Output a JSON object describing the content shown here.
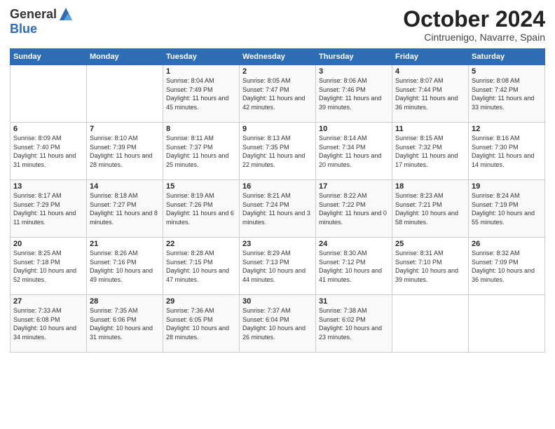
{
  "header": {
    "logo_line1": "General",
    "logo_line2": "Blue",
    "month_title": "October 2024",
    "subtitle": "Cintruenigo, Navarre, Spain"
  },
  "days_of_week": [
    "Sunday",
    "Monday",
    "Tuesday",
    "Wednesday",
    "Thursday",
    "Friday",
    "Saturday"
  ],
  "weeks": [
    [
      {
        "day": "",
        "info": ""
      },
      {
        "day": "",
        "info": ""
      },
      {
        "day": "1",
        "info": "Sunrise: 8:04 AM\nSunset: 7:49 PM\nDaylight: 11 hours and 45 minutes."
      },
      {
        "day": "2",
        "info": "Sunrise: 8:05 AM\nSunset: 7:47 PM\nDaylight: 11 hours and 42 minutes."
      },
      {
        "day": "3",
        "info": "Sunrise: 8:06 AM\nSunset: 7:46 PM\nDaylight: 11 hours and 39 minutes."
      },
      {
        "day": "4",
        "info": "Sunrise: 8:07 AM\nSunset: 7:44 PM\nDaylight: 11 hours and 36 minutes."
      },
      {
        "day": "5",
        "info": "Sunrise: 8:08 AM\nSunset: 7:42 PM\nDaylight: 11 hours and 33 minutes."
      }
    ],
    [
      {
        "day": "6",
        "info": "Sunrise: 8:09 AM\nSunset: 7:40 PM\nDaylight: 11 hours and 31 minutes."
      },
      {
        "day": "7",
        "info": "Sunrise: 8:10 AM\nSunset: 7:39 PM\nDaylight: 11 hours and 28 minutes."
      },
      {
        "day": "8",
        "info": "Sunrise: 8:11 AM\nSunset: 7:37 PM\nDaylight: 11 hours and 25 minutes."
      },
      {
        "day": "9",
        "info": "Sunrise: 8:13 AM\nSunset: 7:35 PM\nDaylight: 11 hours and 22 minutes."
      },
      {
        "day": "10",
        "info": "Sunrise: 8:14 AM\nSunset: 7:34 PM\nDaylight: 11 hours and 20 minutes."
      },
      {
        "day": "11",
        "info": "Sunrise: 8:15 AM\nSunset: 7:32 PM\nDaylight: 11 hours and 17 minutes."
      },
      {
        "day": "12",
        "info": "Sunrise: 8:16 AM\nSunset: 7:30 PM\nDaylight: 11 hours and 14 minutes."
      }
    ],
    [
      {
        "day": "13",
        "info": "Sunrise: 8:17 AM\nSunset: 7:29 PM\nDaylight: 11 hours and 11 minutes."
      },
      {
        "day": "14",
        "info": "Sunrise: 8:18 AM\nSunset: 7:27 PM\nDaylight: 11 hours and 8 minutes."
      },
      {
        "day": "15",
        "info": "Sunrise: 8:19 AM\nSunset: 7:26 PM\nDaylight: 11 hours and 6 minutes."
      },
      {
        "day": "16",
        "info": "Sunrise: 8:21 AM\nSunset: 7:24 PM\nDaylight: 11 hours and 3 minutes."
      },
      {
        "day": "17",
        "info": "Sunrise: 8:22 AM\nSunset: 7:22 PM\nDaylight: 11 hours and 0 minutes."
      },
      {
        "day": "18",
        "info": "Sunrise: 8:23 AM\nSunset: 7:21 PM\nDaylight: 10 hours and 58 minutes."
      },
      {
        "day": "19",
        "info": "Sunrise: 8:24 AM\nSunset: 7:19 PM\nDaylight: 10 hours and 55 minutes."
      }
    ],
    [
      {
        "day": "20",
        "info": "Sunrise: 8:25 AM\nSunset: 7:18 PM\nDaylight: 10 hours and 52 minutes."
      },
      {
        "day": "21",
        "info": "Sunrise: 8:26 AM\nSunset: 7:16 PM\nDaylight: 10 hours and 49 minutes."
      },
      {
        "day": "22",
        "info": "Sunrise: 8:28 AM\nSunset: 7:15 PM\nDaylight: 10 hours and 47 minutes."
      },
      {
        "day": "23",
        "info": "Sunrise: 8:29 AM\nSunset: 7:13 PM\nDaylight: 10 hours and 44 minutes."
      },
      {
        "day": "24",
        "info": "Sunrise: 8:30 AM\nSunset: 7:12 PM\nDaylight: 10 hours and 41 minutes."
      },
      {
        "day": "25",
        "info": "Sunrise: 8:31 AM\nSunset: 7:10 PM\nDaylight: 10 hours and 39 minutes."
      },
      {
        "day": "26",
        "info": "Sunrise: 8:32 AM\nSunset: 7:09 PM\nDaylight: 10 hours and 36 minutes."
      }
    ],
    [
      {
        "day": "27",
        "info": "Sunrise: 7:33 AM\nSunset: 6:08 PM\nDaylight: 10 hours and 34 minutes."
      },
      {
        "day": "28",
        "info": "Sunrise: 7:35 AM\nSunset: 6:06 PM\nDaylight: 10 hours and 31 minutes."
      },
      {
        "day": "29",
        "info": "Sunrise: 7:36 AM\nSunset: 6:05 PM\nDaylight: 10 hours and 28 minutes."
      },
      {
        "day": "30",
        "info": "Sunrise: 7:37 AM\nSunset: 6:04 PM\nDaylight: 10 hours and 26 minutes."
      },
      {
        "day": "31",
        "info": "Sunrise: 7:38 AM\nSunset: 6:02 PM\nDaylight: 10 hours and 23 minutes."
      },
      {
        "day": "",
        "info": ""
      },
      {
        "day": "",
        "info": ""
      }
    ]
  ]
}
